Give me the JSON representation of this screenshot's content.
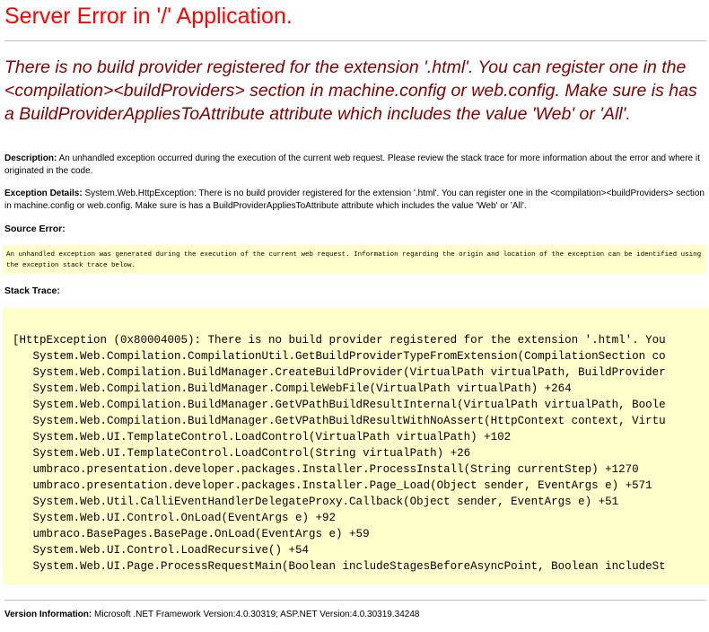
{
  "title": "Server Error in '/' Application.",
  "message": "There is no build provider registered for the extension '.html'. You can register one in the <compilation><buildProviders> section in machine.config or web.config. Make sure is has a BuildProviderAppliesToAttribute attribute which includes the value 'Web' or 'All'.",
  "description": {
    "label": "Description:",
    "text": "An unhandled exception occurred during the execution of the current web request. Please review the stack trace for more information about the error and where it originated in the code."
  },
  "exception_details": {
    "label": "Exception Details:",
    "text": "System.Web.HttpException: There is no build provider registered for the extension '.html'. You can register one in the <compilation><buildProviders> section in machine.config or web.config. Make sure is has a BuildProviderAppliesToAttribute attribute which includes the value 'Web' or 'All'."
  },
  "source_error": {
    "label": "Source Error:",
    "text": "An unhandled exception was generated during the execution of the current web request. Information regarding the origin and location of the exception can be identified using the exception stack trace below."
  },
  "stack_trace": {
    "label": "Stack Trace:",
    "lines": [
      "[HttpException (0x80004005): There is no build provider registered for the extension '.html'. You",
      "   System.Web.Compilation.CompilationUtil.GetBuildProviderTypeFromExtension(CompilationSection co",
      "   System.Web.Compilation.BuildManager.CreateBuildProvider(VirtualPath virtualPath, BuildProvider",
      "   System.Web.Compilation.BuildManager.CompileWebFile(VirtualPath virtualPath) +264",
      "   System.Web.Compilation.BuildManager.GetVPathBuildResultInternal(VirtualPath virtualPath, Boole",
      "   System.Web.Compilation.BuildManager.GetVPathBuildResultWithNoAssert(HttpContext context, Virtu",
      "   System.Web.UI.TemplateControl.LoadControl(VirtualPath virtualPath) +102",
      "   System.Web.UI.TemplateControl.LoadControl(String virtualPath) +26",
      "   umbraco.presentation.developer.packages.Installer.ProcessInstall(String currentStep) +1270",
      "   umbraco.presentation.developer.packages.Installer.Page_Load(Object sender, EventArgs e) +571",
      "   System.Web.Util.CalliEventHandlerDelegateProxy.Callback(Object sender, EventArgs e) +51",
      "   System.Web.UI.Control.OnLoad(EventArgs e) +92",
      "   umbraco.BasePages.BasePage.OnLoad(EventArgs e) +59",
      "   System.Web.UI.Control.LoadRecursive() +54",
      "   System.Web.UI.Page.ProcessRequestMain(Boolean includeStagesBeforeAsyncPoint, Boolean includeSt"
    ]
  },
  "version_info": {
    "label": "Version Information:",
    "text": "Microsoft .NET Framework Version:4.0.30319; ASP.NET Version:4.0.30319.34248"
  },
  "colors": {
    "title": "#ff0000",
    "message": "#800000",
    "code_background": "#ffffcc",
    "rule": "#c0c0c0"
  }
}
